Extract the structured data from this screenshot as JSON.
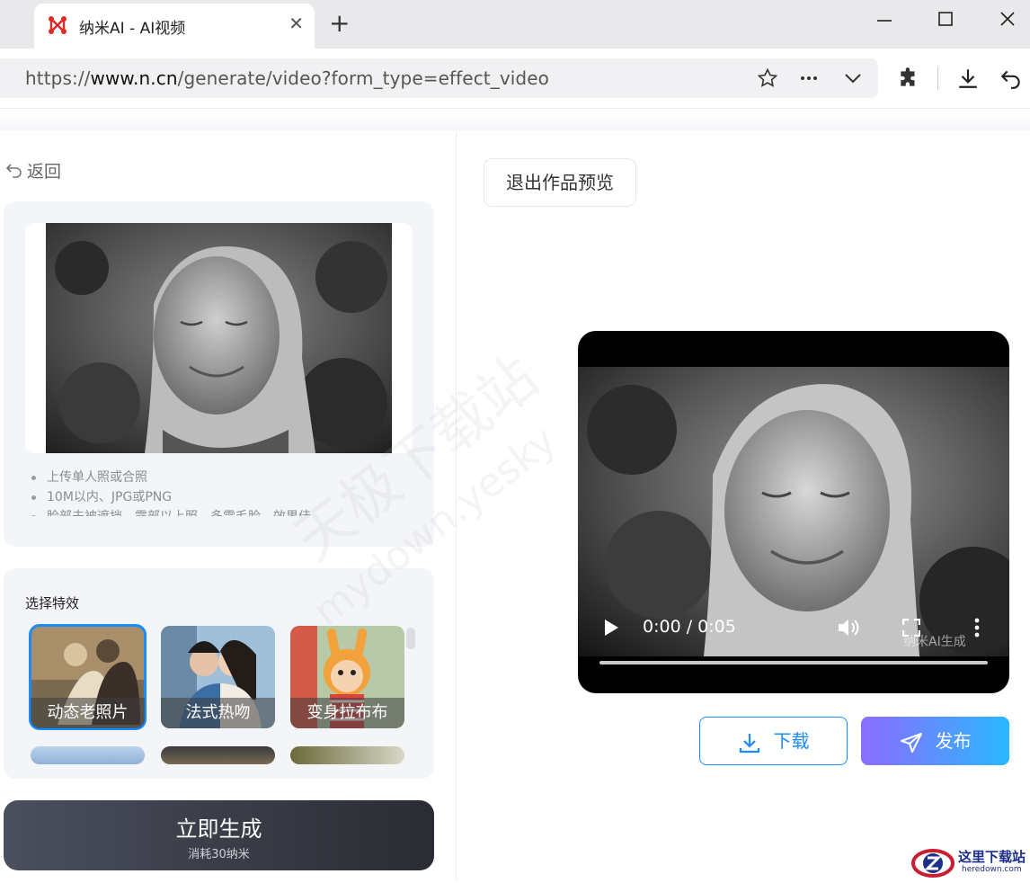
{
  "browser": {
    "tab_title": "纳米AI - AI视频",
    "close_glyph": "✕",
    "newtab_glyph": "+",
    "url_scheme": "https://",
    "url_host": "www.n.cn",
    "url_path": "/generate/video?form_type=effect_video"
  },
  "page": {
    "back_label": "返回",
    "tips": [
      "上传单人照或合照",
      "10M以内、JPG或PNG",
      "脸部未被遮挡，露部以上照，多需毛脸，效果佳"
    ],
    "effects_title": "选择特效",
    "effects": [
      {
        "label": "动态老照片",
        "selected": true
      },
      {
        "label": "法式热吻",
        "selected": false
      },
      {
        "label": "变身拉布布",
        "selected": false
      }
    ],
    "generate_label": "立即生成",
    "generate_cost": "消耗30纳米",
    "exit_preview_label": "退出作品预览",
    "video_time": "0:00 / 0:05",
    "video_progress": 0,
    "video_watermark": "纳米AI生成",
    "download_label": "下载",
    "publish_label": "发布",
    "watermark_1": "天极下载站",
    "watermark_2": "mydown.yesky",
    "corner_logo_text": "这里下载站",
    "corner_logo_sub": "heredown.com"
  },
  "colors": {
    "accent": "#1a8cff",
    "selected_outline": "#1a8cff"
  }
}
